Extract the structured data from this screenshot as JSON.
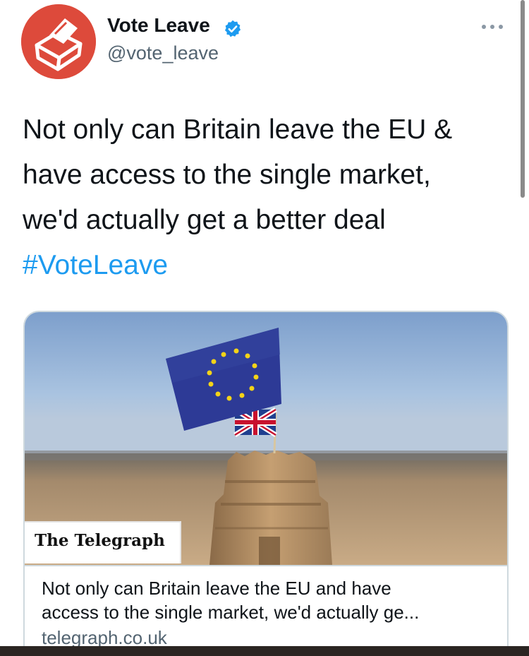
{
  "tweet": {
    "author": {
      "display_name": "Vote Leave",
      "handle": "@vote_leave",
      "verified": true,
      "avatar_icon": "vote-leave-ballot-box-logo",
      "avatar_color": "#dd4a3b"
    },
    "more_icon": "ellipsis-icon",
    "text_lines": [
      "Not only can Britain leave the EU &",
      "have access to the single market,",
      "we'd actually get a better deal"
    ],
    "hashtag": "#VoteLeave"
  },
  "card": {
    "image_description_icon": "eu-flag-on-sandcastle-photo",
    "publisher": "The Telegraph",
    "headline_lines": [
      "Not only can Britain leave the EU and have",
      "access to the single market, we'd actually ge..."
    ],
    "domain": "telegraph.co.uk"
  },
  "colors": {
    "link": "#1d9bf0",
    "verified": "#1d9bf0",
    "secondary_text": "#536471",
    "border": "#cfd9de"
  }
}
